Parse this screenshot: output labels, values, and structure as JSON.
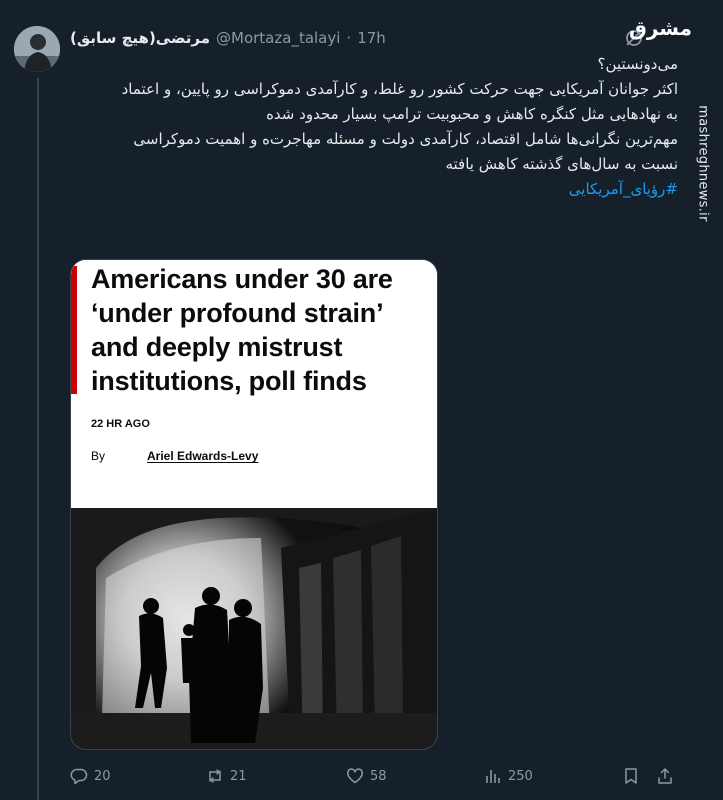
{
  "tweet": {
    "display_name": "مرتضی(هیچ سابق)",
    "handle": "@Mortaza_talayi",
    "separator": "·",
    "time": "17h",
    "question": "می‌دونستین؟",
    "line1": "اکثر جوانان آمریکایی جهت حرکت کشور رو غلط، و کارآمدی دموکراسی رو پایین، و اعتماد",
    "line2": "به نهادهایی مثل کنگره کاهش و محبوبیت ترامپ بسیار محدود شده",
    "line3": "مهم‌ترین نگرانی‌ها شامل اقتصاد، کارآمدی دولت و مسئله مهاجرت‌ه و اهمیت دموکراسی",
    "line4": "نسبت به سال‌های گذشته کاهش یافته",
    "hashtag": "#رؤیای_آمریکایی"
  },
  "watermark": {
    "logo_text": "مشرق",
    "site": "mashreghnews.ir"
  },
  "article": {
    "headline_1": "Americans under 30 are",
    "headline_2": "‘under profound strain’",
    "headline_3": "and deeply mistrust",
    "headline_4": "institutions, poll finds",
    "time_ago": "22 HR AGO",
    "by": "By",
    "author": "Ariel Edwards-Levy"
  },
  "actions": {
    "replies": "20",
    "reposts": "21",
    "likes": "58",
    "views": "250"
  },
  "colors": {
    "background": "#15202b",
    "accent": "#1d9bf0",
    "muted": "#8b98a5",
    "cnn_red": "#cc0000"
  }
}
